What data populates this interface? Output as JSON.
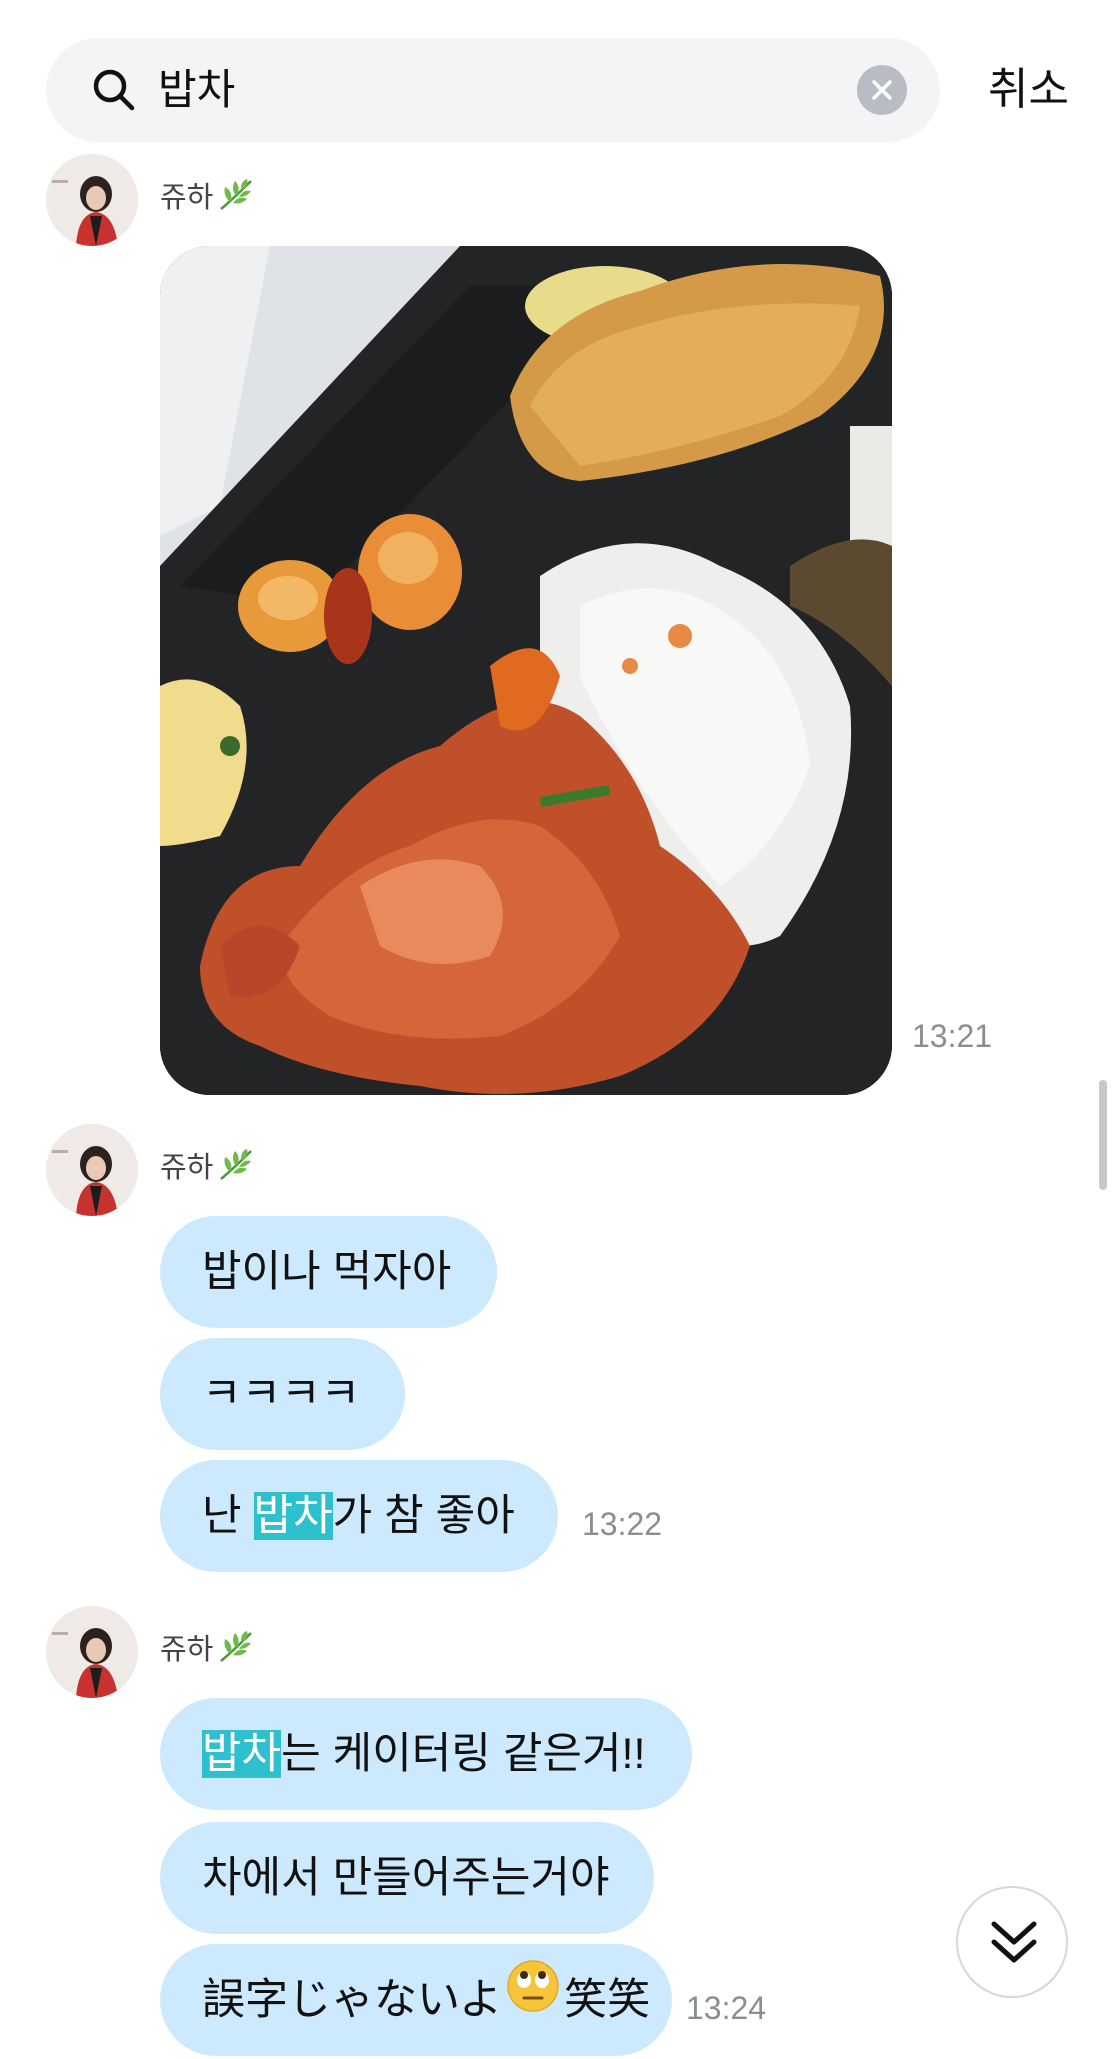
{
  "search": {
    "query": "밥차",
    "cancel_label": "취소"
  },
  "messages": [
    {
      "sender": "쥬하",
      "type": "image",
      "time": "13:21"
    },
    {
      "sender": "쥬하",
      "type": "text",
      "bubbles": [
        "밥이나 먹자아",
        "ㅋㅋㅋㅋ",
        [
          "난 ",
          "밥차",
          "가 참 좋아"
        ]
      ],
      "time": "13:22"
    },
    {
      "sender": "쥬하",
      "type": "text",
      "bubbles": [
        [
          "",
          "밥차",
          "는 케이터링 같은거!!"
        ],
        "차에서 만들어주는거야",
        [
          "誤字じゃないよ",
          "笑笑"
        ]
      ],
      "time": "13:24"
    }
  ],
  "colors": {
    "bubble": "#cde9fd",
    "highlight": "#2fc0d0",
    "search_bg": "#f3f4f6"
  },
  "icons": [
    "search-icon",
    "clear-icon",
    "leaf-icon",
    "eye-roll-emoji",
    "double-chevron-down-icon"
  ]
}
